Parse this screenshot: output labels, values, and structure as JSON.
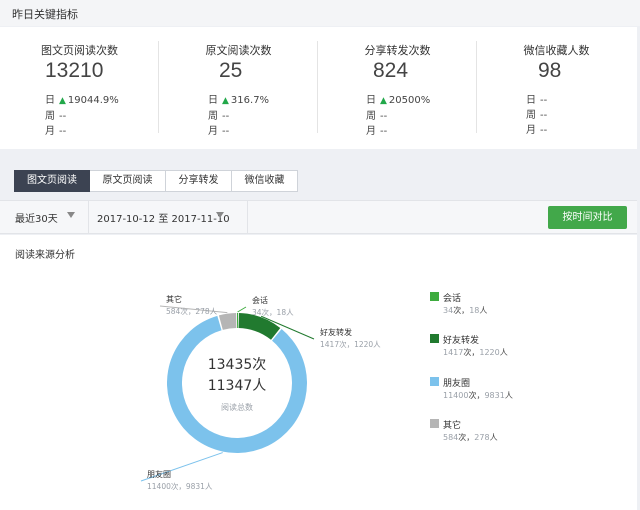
{
  "header": {
    "title": "昨日关键指标"
  },
  "kpis": [
    {
      "title": "图文页阅读次数",
      "value": "13210",
      "day_label": "日",
      "day_change": "19044.9%",
      "week_label": "周",
      "week_value": "--",
      "month_label": "月",
      "month_value": "--"
    },
    {
      "title": "原文阅读次数",
      "value": "25",
      "day_label": "日",
      "day_change": "316.7%",
      "week_label": "周",
      "week_value": "--",
      "month_label": "月",
      "month_value": "--"
    },
    {
      "title": "分享转发次数",
      "value": "824",
      "day_label": "日",
      "day_change": "20500%",
      "week_label": "周",
      "week_value": "--",
      "month_label": "月",
      "month_value": "--"
    },
    {
      "title": "微信收藏人数",
      "value": "98",
      "day_label": "日",
      "day_change": "--",
      "week_label": "周",
      "week_value": "--",
      "month_label": "月",
      "month_value": "--"
    }
  ],
  "tabs": [
    {
      "label": "图文页阅读",
      "active": true
    },
    {
      "label": "原文页阅读",
      "active": false
    },
    {
      "label": "分享转发",
      "active": false
    },
    {
      "label": "微信收藏",
      "active": false
    }
  ],
  "filter": {
    "range_label": "最近30天",
    "date_start": "2017-10-12",
    "date_sep": "至",
    "date_end": "2017-11-10",
    "compare_button": "按时间对比"
  },
  "panel": {
    "title": "阅读来源分析"
  },
  "donut": {
    "center_times": "13435次",
    "center_people": "11347人",
    "center_caption": "阅读总数"
  },
  "chart_data": {
    "type": "pie",
    "title": "阅读来源分析",
    "slices": [
      {
        "name": "会话",
        "times": 34,
        "people": 18,
        "color": "#3dab3e"
      },
      {
        "name": "好友转发",
        "times": 1417,
        "people": 1220,
        "color": "#217a2f"
      },
      {
        "name": "朋友圈",
        "times": 11400,
        "people": 9831,
        "color": "#7cc2ec"
      },
      {
        "name": "其它",
        "times": 584,
        "people": 278,
        "color": "#b5b5b5"
      }
    ],
    "total_times": 13435,
    "total_people": 11347,
    "legend_position": "right"
  },
  "labels": {
    "times_suffix": "次，",
    "people_suffix": "人"
  },
  "colors": {
    "accent_green": "#42a84a",
    "active_tab": "#3c4352",
    "up_arrow": "#22a84a"
  }
}
